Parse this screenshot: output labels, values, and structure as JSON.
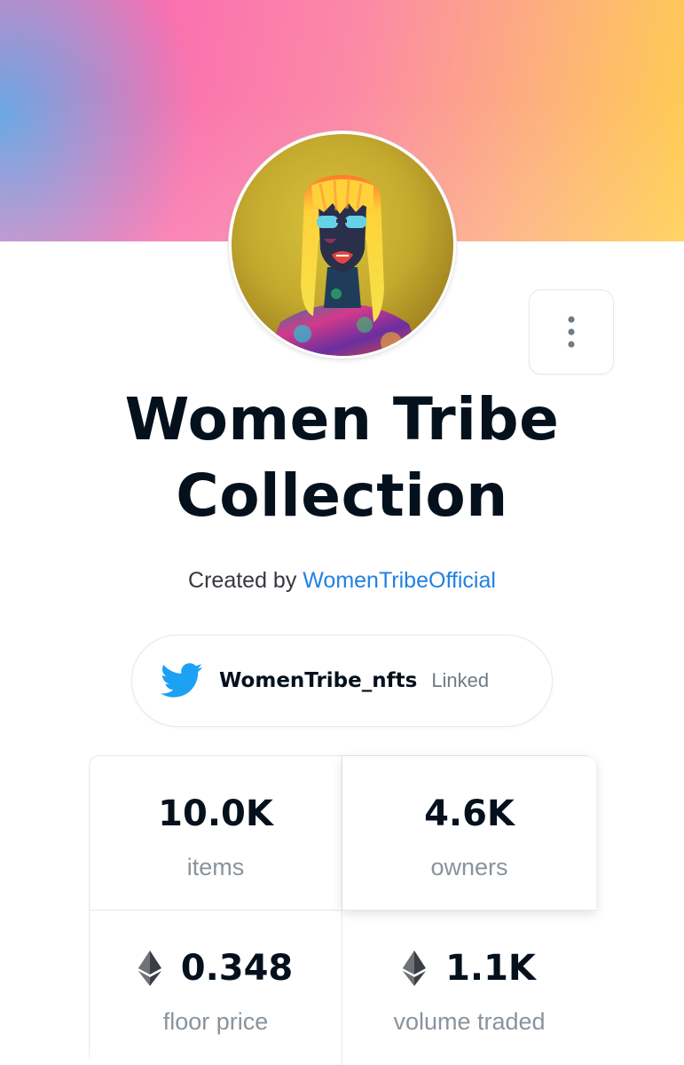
{
  "collection": {
    "title_line1": "Women Tribe",
    "title_line2": "Collection",
    "created_by_prefix": "Created by",
    "creator_name": "WomenTribeOfficial"
  },
  "social": {
    "icon": "twitter-bird-icon",
    "handle": "WomenTribe_nfts",
    "status": "Linked"
  },
  "stats": [
    {
      "value": "10.0K",
      "label": "items",
      "currency_icon": ""
    },
    {
      "value": "4.6K",
      "label": "owners",
      "currency_icon": ""
    },
    {
      "value": "0.348",
      "label": "floor price",
      "currency_icon": "ethereum-icon"
    },
    {
      "value": "1.1K",
      "label": "volume traded",
      "currency_icon": "ethereum-icon"
    }
  ],
  "colors": {
    "accent_link": "#2081e2",
    "twitter_blue": "#1da1f2",
    "title_text": "#04111d",
    "muted_text": "#8a939b"
  }
}
